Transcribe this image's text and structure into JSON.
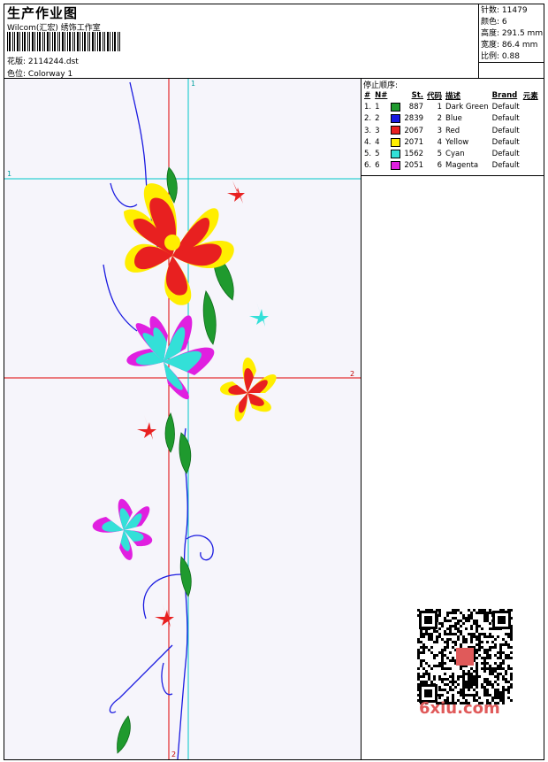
{
  "header": {
    "title": "生产作业图",
    "company": "Wilcom(汇宏) 绣饰工作室",
    "design_label": "花版:",
    "design_value": "2114244.dst",
    "colorway_label": "色位:",
    "colorway_value": "Colorway 1"
  },
  "stats": {
    "stitches_label": "针数:",
    "stitches_value": "11479",
    "colors_label": "颜色:",
    "colors_value": "6",
    "height_label": "高度:",
    "height_value": "291.5 mm",
    "width_label": "宽度:",
    "width_value": "86.4 mm",
    "scale_label": "比例:",
    "scale_value": "0.88"
  },
  "canvas": {
    "guide_top": "1",
    "guide_left": "1",
    "guide_right": "2",
    "guide_bottom": "2"
  },
  "stop_sequence": {
    "title": "停止顺序:",
    "headers": [
      "#",
      "N#",
      "St.",
      "代码",
      "描述",
      "Brand",
      "元素"
    ],
    "rows": [
      {
        "num": "1.",
        "n": "1",
        "st": "887",
        "code": "1",
        "desc": "Dark Green",
        "brand": "Default",
        "color": "#1f9a2e"
      },
      {
        "num": "2.",
        "n": "2",
        "st": "2839",
        "code": "2",
        "desc": "Blue",
        "brand": "Default",
        "color": "#1a1ae0"
      },
      {
        "num": "3.",
        "n": "3",
        "st": "2067",
        "code": "3",
        "desc": "Red",
        "brand": "Default",
        "color": "#e82020"
      },
      {
        "num": "4.",
        "n": "4",
        "st": "2071",
        "code": "4",
        "desc": "Yellow",
        "brand": "Default",
        "color": "#ffee00"
      },
      {
        "num": "5.",
        "n": "5",
        "st": "1562",
        "code": "5",
        "desc": "Cyan",
        "brand": "Default",
        "color": "#33e0d8"
      },
      {
        "num": "6.",
        "n": "6",
        "st": "2051",
        "code": "6",
        "desc": "Magenta",
        "brand": "Default",
        "color": "#e020e0"
      }
    ]
  },
  "watermark": {
    "logo_text": "6xiu.com",
    "qr_icon": "qr-code-icon"
  }
}
